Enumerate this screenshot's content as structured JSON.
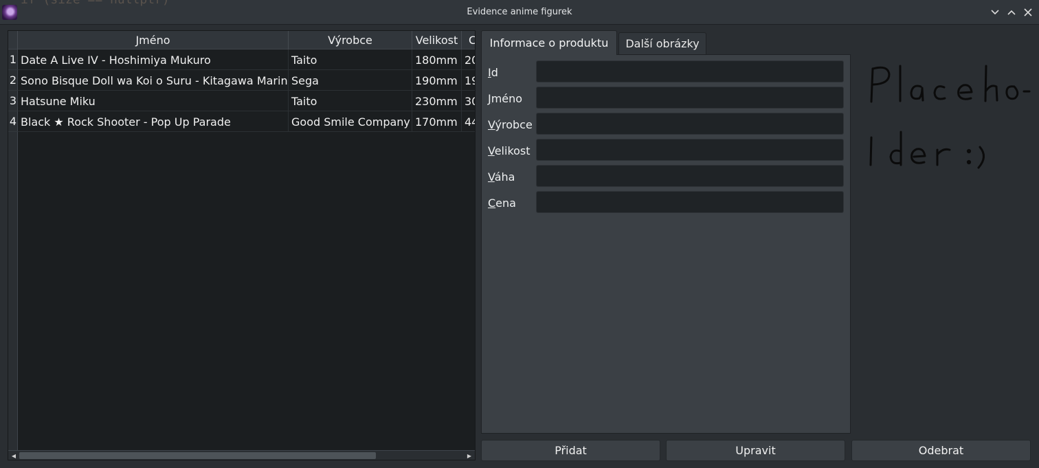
{
  "window": {
    "title": "Evidence anime figurek",
    "background_code_text": "if (size == nullptr)"
  },
  "table": {
    "headers": [
      "Jméno",
      "Výrobce",
      "Velikost",
      "C"
    ],
    "row_numbers": [
      "1",
      "2",
      "3",
      "4"
    ],
    "rows": [
      [
        "Date A Live IV - Hoshimiya Mukuro",
        "Taito",
        "180mm",
        "20"
      ],
      [
        "Sono Bisque Doll wa Koi o Suru - Kitagawa Marin",
        "Sega",
        "190mm",
        "19"
      ],
      [
        "Hatsune Miku",
        "Taito",
        "230mm",
        "30"
      ],
      [
        "Black ★ Rock Shooter - Pop Up Parade",
        "Good Smile Company",
        "170mm",
        "44"
      ]
    ]
  },
  "tabs": {
    "active": "Informace o produktu",
    "other": "Další obrázky"
  },
  "form": {
    "fields": [
      {
        "mnemonic": "I",
        "rest": "d",
        "value": ""
      },
      {
        "mnemonic": "J",
        "rest": "méno",
        "value": ""
      },
      {
        "mnemonic": "V",
        "rest": "ýrobce",
        "value": ""
      },
      {
        "mnemonic": "V",
        "rest": "elikost",
        "value": ""
      },
      {
        "mnemonic": "V",
        "rest": "áha",
        "value": ""
      },
      {
        "mnemonic": "C",
        "rest": "ena",
        "value": ""
      }
    ]
  },
  "image": {
    "handwritten_text": "Placeholder :)"
  },
  "buttons": {
    "add": "Přidat",
    "edit": "Upravit",
    "remove": "Odebrat"
  }
}
